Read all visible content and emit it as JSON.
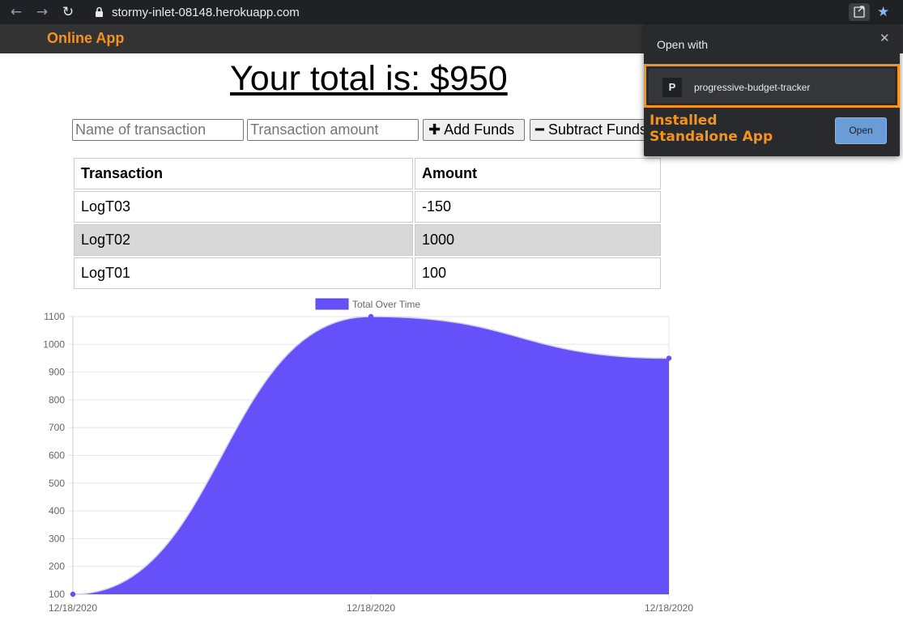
{
  "browser": {
    "url": "stormy-inlet-08148.herokuapp.com",
    "back_icon": "←",
    "forward_icon": "→",
    "reload_icon": "↻",
    "star_icon": "★"
  },
  "navbar": {
    "brand": "Online App"
  },
  "total": {
    "text": "Your total is: $950"
  },
  "form": {
    "name_placeholder": "Name of transaction",
    "amount_placeholder": "Transaction amount",
    "add_icon": "✚",
    "add_label": " Add Funds",
    "subtract_icon": "━",
    "subtract_label": " Subtract Funds"
  },
  "table": {
    "headers": [
      "Transaction",
      "Amount"
    ],
    "rows": [
      {
        "name": "LogT03",
        "amount": "-150"
      },
      {
        "name": "LogT02",
        "amount": "1000"
      },
      {
        "name": "LogT01",
        "amount": "100"
      }
    ]
  },
  "popup": {
    "title": "Open with",
    "close_icon": "✕",
    "app_letter": "P",
    "app_name": "progressive-budget-tracker",
    "annotation_line1": "Installed",
    "annotation_line2": "Standalone App",
    "open_label": "Open"
  },
  "chart_data": {
    "type": "area",
    "legend": "Total Over Time",
    "legend_position": "top",
    "x": [
      "12/18/2020",
      "12/18/2020",
      "12/18/2020"
    ],
    "series": [
      {
        "name": "Total Over Time",
        "values": [
          100,
          1100,
          950
        ],
        "color": "#6650fa"
      }
    ],
    "y_ticks": [
      100,
      200,
      300,
      400,
      500,
      600,
      700,
      800,
      900,
      1000,
      1100
    ],
    "ylim": [
      100,
      1100
    ],
    "grid": true
  }
}
